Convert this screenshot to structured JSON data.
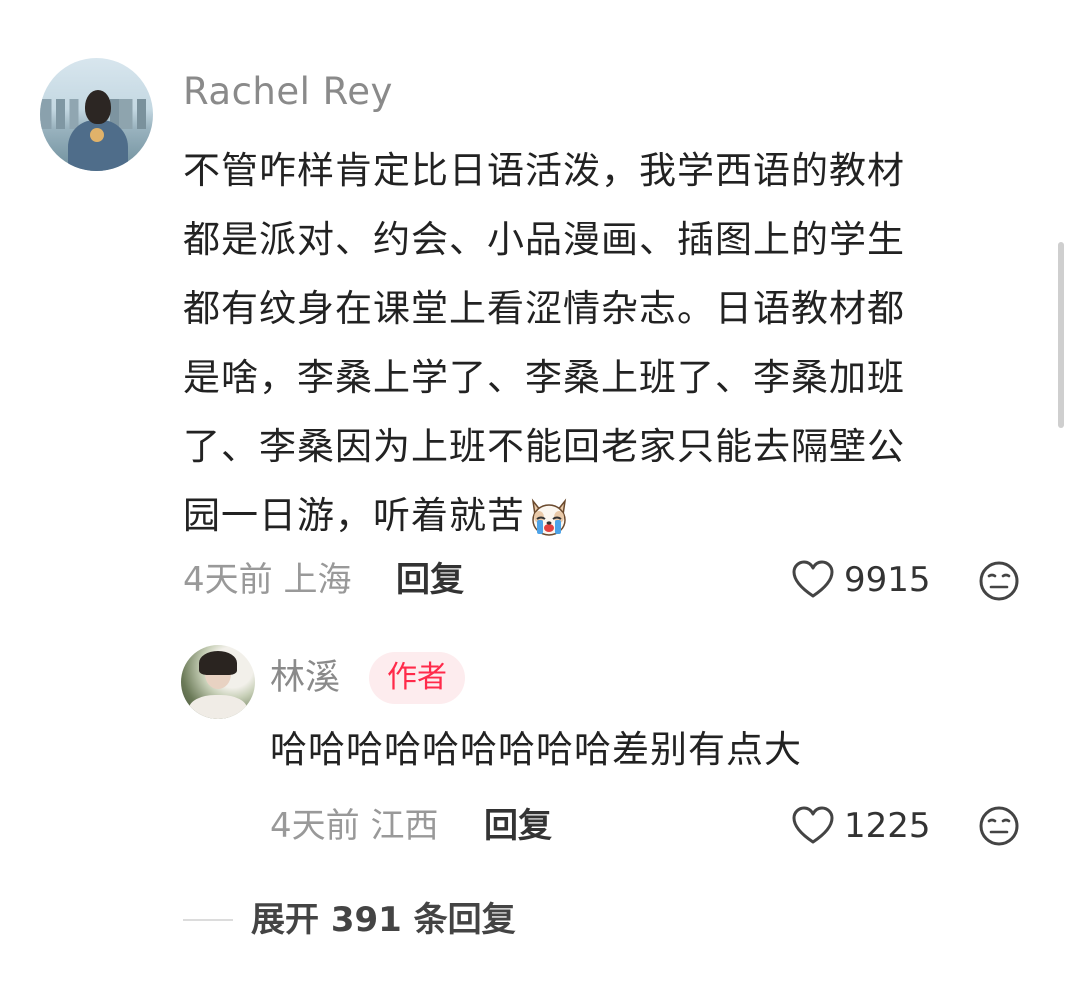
{
  "comment": {
    "username": "Rachel Rey",
    "text_lines": [
      "不管咋样肯定比日语活泼，我学西语的教材",
      "都是派对、约会、小品漫画、插图上的学生",
      "都有纹身在课堂上看涩情杂志。日语教材都",
      "是啥，李桑上学了、李桑上班了、李桑加班",
      "了、李桑因为上班不能回老家只能去隔壁公",
      "园一日游，听着就苦"
    ],
    "time": "4天前",
    "location": "上海",
    "reply_label": "回复",
    "likes": "9915"
  },
  "reply": {
    "username": "林溪",
    "badge": "作者",
    "text": "哈哈哈哈哈哈哈哈哈差别有点大",
    "time": "4天前",
    "location": "江西",
    "reply_label": "回复",
    "likes": "1225"
  },
  "expand": {
    "label": "展开 391 条回复"
  },
  "icons": {
    "like": "heart-outline-icon",
    "dislike": "neutral-face-icon",
    "emoji": "crying-dog-emoji"
  },
  "colors": {
    "badge_bg": "#fdecee",
    "badge_text": "#ff2a4a",
    "meta_text": "#999999"
  }
}
